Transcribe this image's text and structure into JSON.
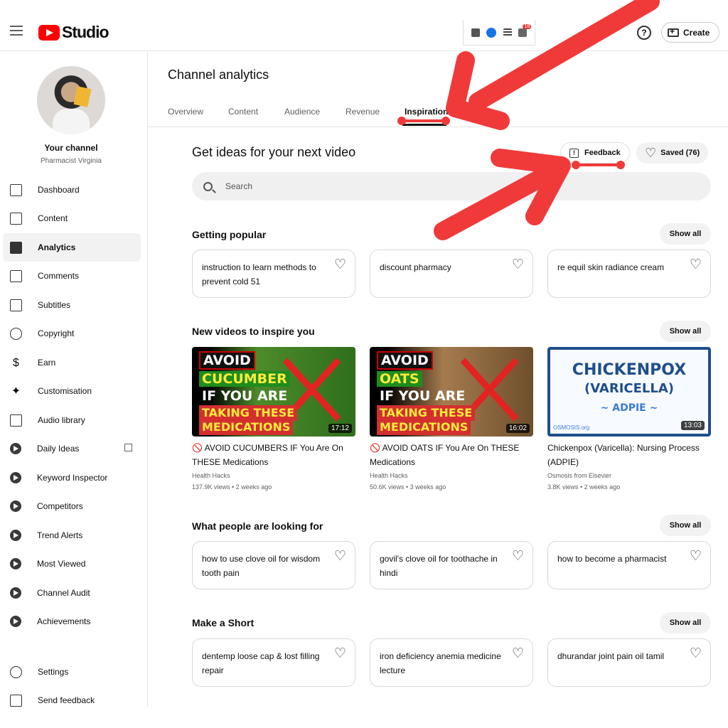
{
  "header": {
    "logo_text": "Studio",
    "create_label": "Create",
    "help_symbol": "?",
    "ext_badge": "18"
  },
  "sidebar": {
    "channel_title": "Your channel",
    "channel_name": "Pharmacist Virginia",
    "items": [
      {
        "label": "Dashboard",
        "icon": "dashboard-icon"
      },
      {
        "label": "Content",
        "icon": "content-icon"
      },
      {
        "label": "Analytics",
        "icon": "analytics-icon"
      },
      {
        "label": "Comments",
        "icon": "comments-icon"
      },
      {
        "label": "Subtitles",
        "icon": "subtitles-icon"
      },
      {
        "label": "Copyright",
        "icon": "copyright-icon"
      },
      {
        "label": "Earn",
        "icon": "dollar-icon"
      },
      {
        "label": "Customisation",
        "icon": "wand-icon"
      },
      {
        "label": "Audio library",
        "icon": "audio-library-icon"
      },
      {
        "label": "Daily Ideas",
        "icon": "extension-icon"
      },
      {
        "label": "Keyword Inspector",
        "icon": "extension-icon"
      },
      {
        "label": "Competitors",
        "icon": "extension-icon"
      },
      {
        "label": "Trend Alerts",
        "icon": "extension-icon"
      },
      {
        "label": "Most Viewed",
        "icon": "extension-icon"
      },
      {
        "label": "Channel Audit",
        "icon": "extension-icon"
      },
      {
        "label": "Achievements",
        "icon": "extension-icon"
      },
      {
        "label": "Settings",
        "icon": "gear-icon"
      },
      {
        "label": "Send feedback",
        "icon": "feedback-icon"
      }
    ]
  },
  "main": {
    "page_title": "Channel analytics",
    "tabs": [
      "Overview",
      "Content",
      "Audience",
      "Revenue",
      "Inspiration"
    ],
    "active_tab": "Inspiration",
    "ideas_title": "Get ideas for your next video",
    "feedback_label": "Feedback",
    "saved_label": "Saved (76)",
    "search_placeholder": "Search",
    "show_all": "Show all",
    "sections": {
      "getting_popular": {
        "title": "Getting popular",
        "cards": [
          "instruction to learn methods to prevent cold 51",
          "discount pharmacy",
          "re equil skin radiance cream"
        ]
      },
      "new_videos": {
        "title": "New videos to inspire you",
        "videos": [
          {
            "title": "🚫 AVOID CUCUMBERS IF You Are On THESE Medications",
            "channel": "Health Hacks",
            "meta": "137.9K views • 2 weeks ago",
            "duration": "17:12",
            "thumb": [
              "AVOID",
              "CUCUMBER",
              "IF YOU ARE",
              "TAKING THESE",
              "MEDICATIONS"
            ]
          },
          {
            "title": "🚫 AVOID OATS IF You Are On THESE Medications",
            "channel": "Health Hacks",
            "meta": "50.6K views • 3 weeks ago",
            "duration": "16:02",
            "thumb": [
              "AVOID",
              "OATS",
              "IF YOU ARE",
              "TAKING THESE",
              "MEDICATIONS"
            ]
          },
          {
            "title": "Chickenpox (Varicella): Nursing Process (ADPIE)",
            "channel": "Osmosis from Elsevier",
            "meta": "3.8K views • 2 weeks ago",
            "duration": "13:03",
            "thumb": [
              "CHICKENPOX",
              "(VARICELLA)",
              "~ ADPIE ~",
              "OSMOSIS.org"
            ]
          }
        ]
      },
      "looking_for": {
        "title": "What people are looking for",
        "cards": [
          "how to use clove oil for wisdom tooth pain",
          "govil's clove oil for toothache in hindi",
          "how to become a pharmacist"
        ]
      },
      "make_short": {
        "title": "Make a Short",
        "cards": [
          "dentemp loose cap & lost filling repair",
          "iron deficiency anemia medicine lecture",
          "dhurandar joint pain oil tamil"
        ]
      }
    }
  },
  "colors": {
    "brand_red": "#ff0000",
    "annotation_red": "#f03a3a",
    "active_bg": "#f2f2f2"
  }
}
